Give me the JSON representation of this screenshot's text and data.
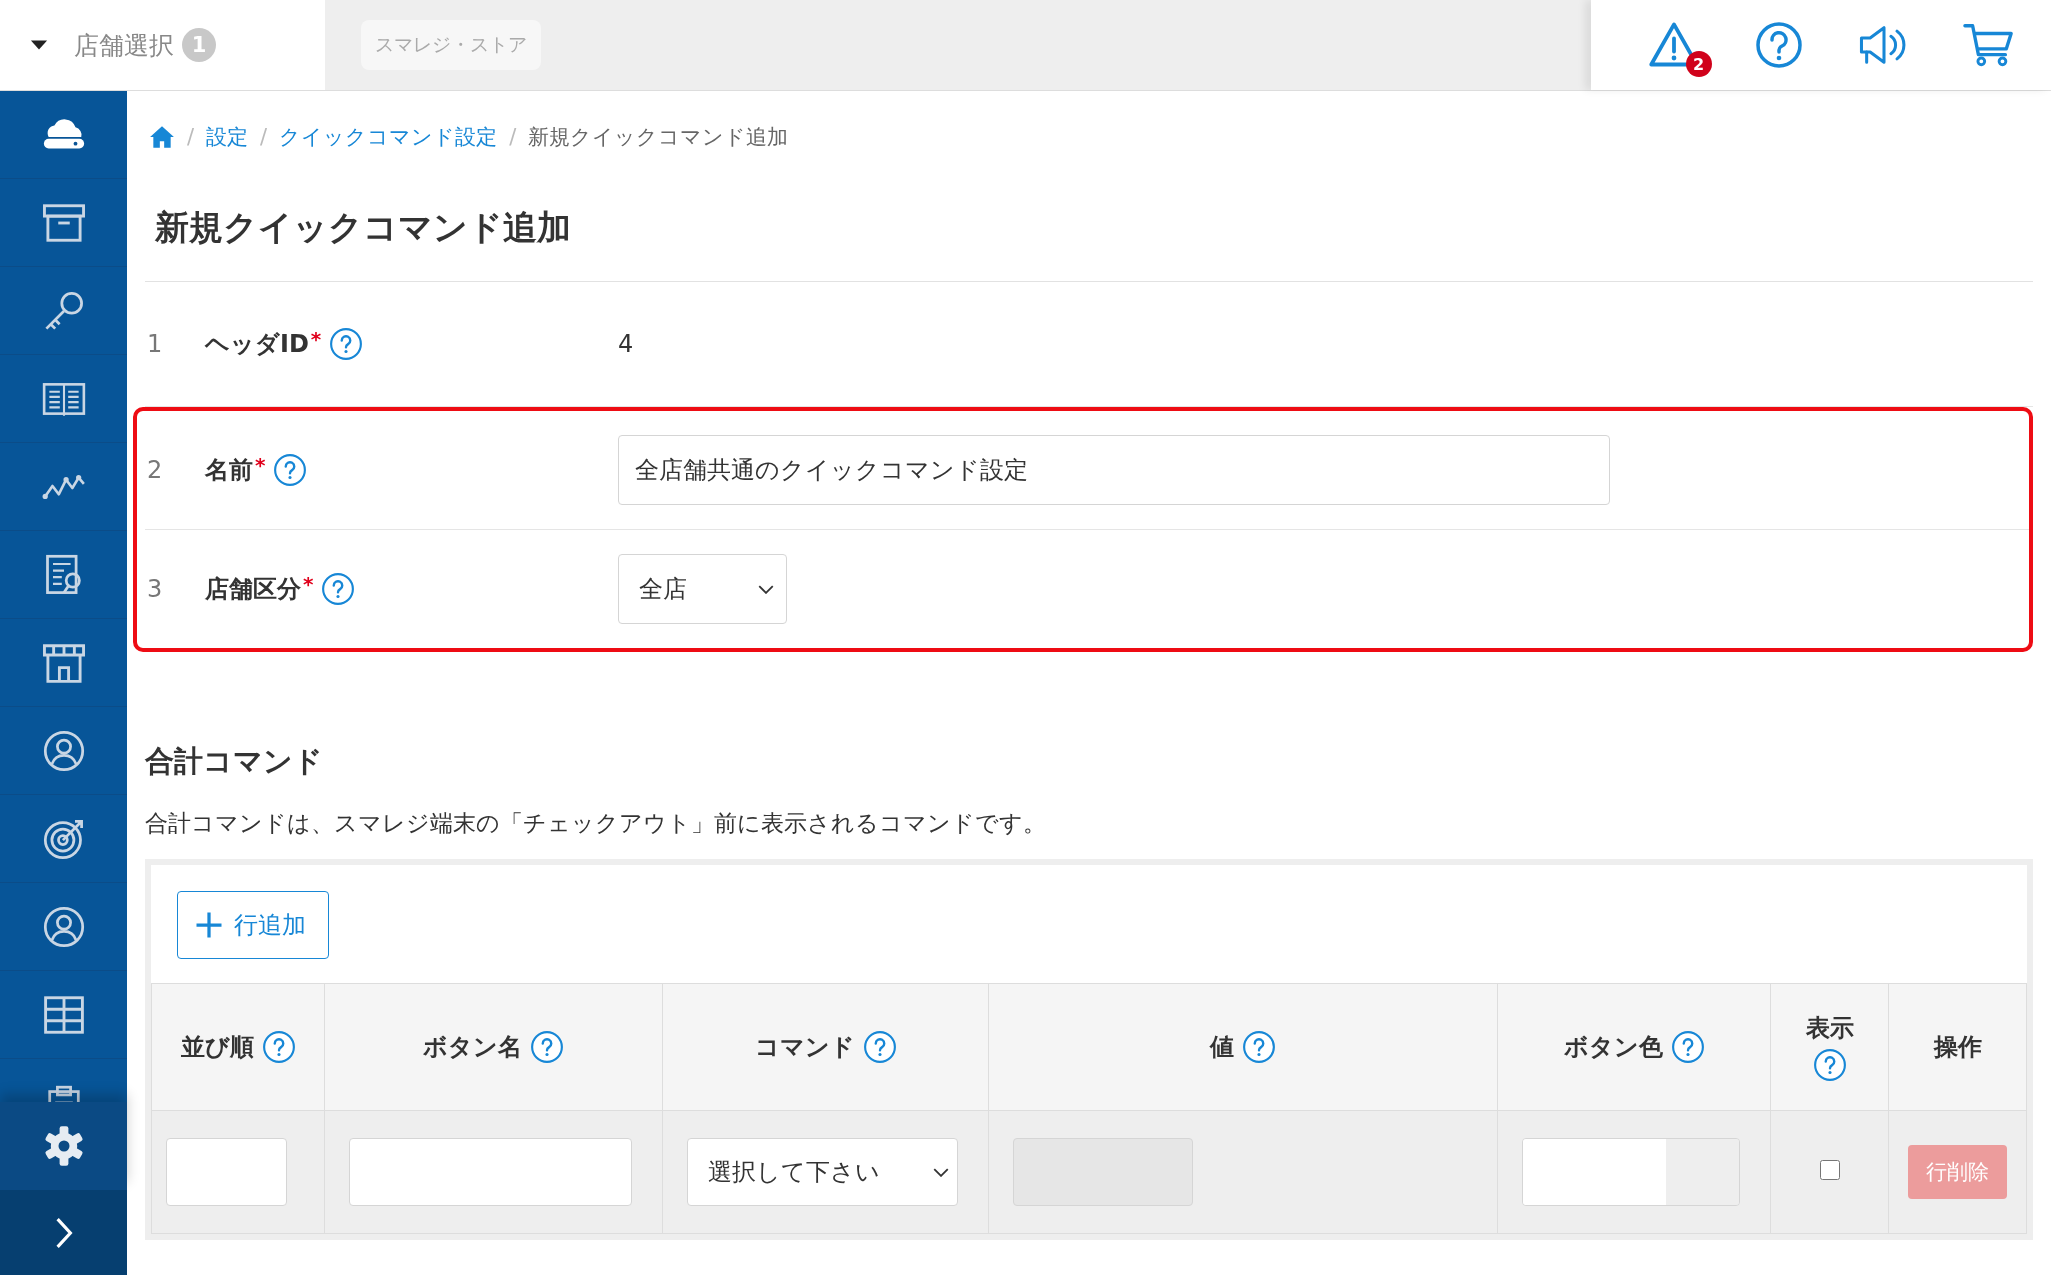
{
  "top_bar": {
    "store_selector": {
      "label": "店舗選択",
      "count": "1"
    },
    "store_name": "スマレジ・ストア",
    "alert_count": "2"
  },
  "breadcrumb": [
    {
      "separator": "/",
      "label": "設定",
      "link": true
    },
    {
      "separator": "/",
      "label": "クイックコマンド設定",
      "link": true
    },
    {
      "separator": "/",
      "label": "新規クイックコマンド追加",
      "link": false
    }
  ],
  "title": "新規クイックコマンド追加",
  "form": {
    "rows": [
      {
        "number": "1",
        "label": "ヘッダID",
        "required_mark": "*",
        "kind": "text",
        "value": "4",
        "highlighted": false
      },
      {
        "number": "2",
        "label": "名前",
        "required_mark": "*",
        "kind": "input",
        "value": "全店舗共通のクイックコマンド設定",
        "highlighted": true
      },
      {
        "number": "3",
        "label": "店舗区分",
        "required_mark": "*",
        "kind": "select",
        "value": "全店",
        "highlighted": true
      }
    ]
  },
  "section": {
    "title": "合計コマンド",
    "description": "合計コマンドは、スマレジ端末の「チェックアウト」前に表示されるコマンドです。",
    "add_button": "行追加",
    "table": {
      "columns": [
        {
          "label": "並び順",
          "help": true
        },
        {
          "label": "ボタン名",
          "help": true
        },
        {
          "label": "コマンド",
          "help": true
        },
        {
          "label": "値",
          "help": true
        },
        {
          "label": "ボタン色",
          "help": true
        },
        {
          "label": "表示",
          "help": true
        },
        {
          "label": "操作",
          "help": false
        }
      ],
      "rows": [
        {
          "order": {
            "disabled": false
          },
          "name": {
            "disabled": false
          },
          "command": {
            "value": "選択して下さい"
          },
          "value": {
            "disabled": true
          },
          "display": {
            "checked": false
          },
          "delete": {
            "label": "行削除",
            "disabled": true
          }
        }
      ]
    }
  }
}
